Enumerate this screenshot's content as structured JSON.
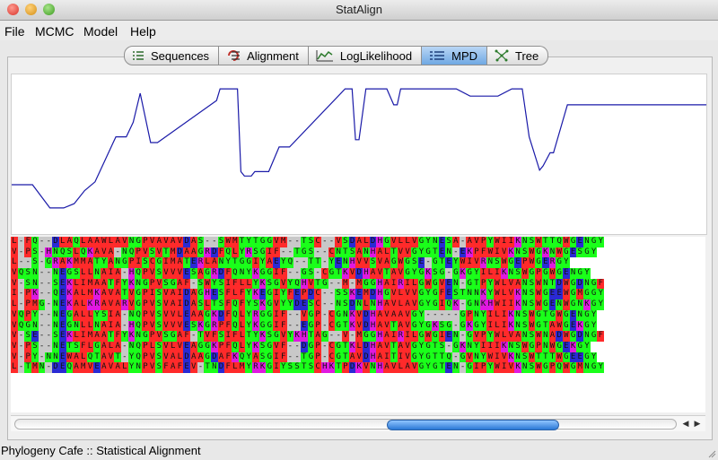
{
  "window": {
    "title": "StatAlign"
  },
  "menu": [
    {
      "label": "File"
    },
    {
      "label": "MCMC"
    },
    {
      "label": "Model"
    },
    {
      "label": "Help"
    }
  ],
  "tabs": [
    {
      "label": "Sequences",
      "icon": "list-icon",
      "selected": false
    },
    {
      "label": "Alignment",
      "icon": "alignment-icon",
      "selected": false
    },
    {
      "label": "LogLikelihood",
      "icon": "line-chart-icon",
      "selected": false
    },
    {
      "label": "MPD",
      "icon": "mpd-icon",
      "selected": true
    },
    {
      "label": "Tree",
      "icon": "tree-icon",
      "selected": false
    }
  ],
  "chart_data": {
    "type": "line",
    "title": "",
    "xlabel": "",
    "ylabel": "",
    "grid": false,
    "color": "#1a1aa8",
    "note_scale": "normalized 0-1",
    "x": [
      0,
      0.03,
      0.055,
      0.06,
      0.075,
      0.09,
      0.105,
      0.12,
      0.15,
      0.165,
      0.175,
      0.185,
      0.2,
      0.21,
      0.295,
      0.3,
      0.31,
      0.325,
      0.33,
      0.335,
      0.345,
      0.35,
      0.37,
      0.385,
      0.39,
      0.4,
      0.48,
      0.49,
      0.495,
      0.5,
      0.51,
      0.52,
      0.54,
      0.55,
      0.555,
      0.56,
      0.565,
      0.57,
      0.6,
      0.605,
      0.61,
      0.62,
      0.64,
      0.66,
      0.7,
      0.72,
      0.735,
      0.745,
      0.76,
      0.765,
      0.775,
      0.78,
      0.8,
      1.0
    ],
    "y": [
      0.29,
      0.29,
      0.13,
      0.13,
      0.13,
      0.16,
      0.25,
      0.31,
      0.62,
      0.62,
      0.72,
      0.92,
      0.58,
      0.58,
      0.87,
      0.95,
      0.95,
      0.95,
      0.38,
      0.35,
      0.35,
      0.38,
      0.38,
      0.55,
      0.55,
      0.55,
      0.95,
      0.95,
      0.6,
      0.6,
      0.95,
      0.95,
      0.95,
      0.84,
      0.84,
      0.95,
      0.95,
      0.95,
      0.95,
      0.95,
      0.95,
      0.95,
      0.95,
      0.9,
      0.9,
      0.95,
      0.95,
      0.62,
      0.39,
      0.42,
      0.51,
      0.51,
      0.84,
      0.84
    ],
    "series": [
      {
        "values": []
      }
    ]
  },
  "alignment": {
    "rows": [
      "L-FQ--DLAQLAAWLAVNGPVAVAVDAS--SWMTYTGGVM--TSC--VSDALDHGVLLVGYNESA-AVPYWIIKNSWTTQWGENGY",
      "V-PS-HNQSLQKAVA-NQPVSVTMDAAGRDFQLYRSGIF--TGS--CNTSANHALTVVGYGTEN-EKPFWIVKNSWGKNWGESGY",
      "L--S-GRAKMMATYANGPISCGIMATERLANYTGGIYAEYQ--TT-YENHVVSVAGWGSE-GTEYWIVRNSWGEPWGERGY",
      "VQSN--NEGSLLNAIA-HQPVSVVVESAGRDFQNYKGGIF--GS-CGTKVDHAVTAVGYGKSG-GKGYILIKNSWGPGWGENGY",
      "V-SN--SEKLIMAATFYKNGPVSGAF-SWYSIFLLYKSGVYQHVTG--M-MGGHAIRILGWGVEN-GTPYWLVANSWNTDWGDNGF",
      "I-PK--QEKALMKAVATVGPISVAIDAGHESFLFYKEGIYFEPDC--SSKEMDHGVLVVGYGFESTNNKYWLVKNSWGEEWGMGGY",
      "L-PMG-NEKALKRAVARVGPVSVAIDASLTSFQFYSKGVYYDESC--NSDNLNHAVLAVGYGIQK-GNKHWIIKNSWGENWGNKGY",
      "VQPY--NEGALLYSIA-NQPVSVVLEAAGKDFQLYRGGIF--VGP-CGNKVDHAVAAVGY-----GPNYILIKNSWGTGWGENGY",
      "VQGN--NEGNLLNAIA-HQPVSVVVESKGRPFQLYKGGIF--EGP-CGTKVDHAVTAVGYGKSG-GKGYILIKNSWGTAWGEKGY",
      "V-SE--SEKLIMAATFYKNGPVSGAF-TVFSIFLTYKSGVYKHTAG--V-MGGHAIRILGWGIEN-GVPYWLVANSWNADWGDNGF",
      "V-PS--NETSFLGALA-NQPLSVLVEAGGKPFQLYKSGVF--DGP-CGTKLDHAVTAVGYGTS-GKNYIIIKNSWGPNWGEKGY",
      "V-PY-NNEWALQTAVT-YQPVSVALDAAGDAFKQYASGIF--TGP-CGTAVDHAITIVGYGTTQ-GVNYWIVKNSWTTTWGEEGY",
      "L-TMN-DEQAMVEAVALYNPVSFAFEV-TNDFLMYRKGIYSSTSCHKTPDKVNHAVLAVGYGTEN-GIPYWIVKNSWGPQWGMNGY"
    ]
  },
  "scrollbar": {
    "position": 0.57
  },
  "status": {
    "text": "Phylogeny Cafe :: Statistical Alignment"
  }
}
